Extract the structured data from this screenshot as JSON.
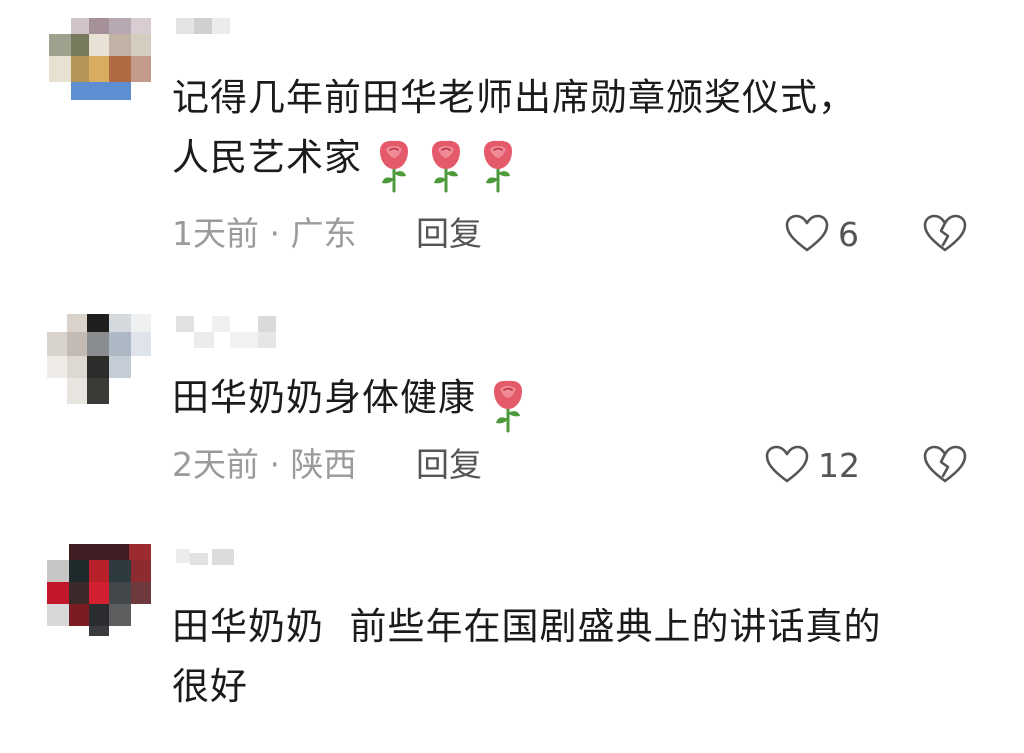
{
  "comments": [
    {
      "lines": [
        "记得几年前田华老师出席勋章颁奖仪式，",
        "人民艺术家"
      ],
      "rose_count": 3,
      "time_location": "1天前 · 广东",
      "reply_label": "回复",
      "like_count": "6",
      "like_icon": "heart-outline-icon",
      "dislike_icon": "broken-heart-icon"
    },
    {
      "lines": [
        "田华奶奶身体健康"
      ],
      "rose_count": 1,
      "time_location": "2天前 · 陕西",
      "reply_label": "回复",
      "like_count": "12",
      "like_icon": "heart-outline-icon",
      "dislike_icon": "broken-heart-icon"
    },
    {
      "lines": [
        "田华奶奶  前些年在国剧盛典上的讲话真的",
        "很好"
      ],
      "rose_count": 0
    }
  ],
  "colors": {
    "text": "#1b1b1b",
    "meta_text": "#9b9b9b",
    "action_text": "#555555",
    "rose_petal": "#e45a6a",
    "rose_stem": "#4d9a3b"
  }
}
